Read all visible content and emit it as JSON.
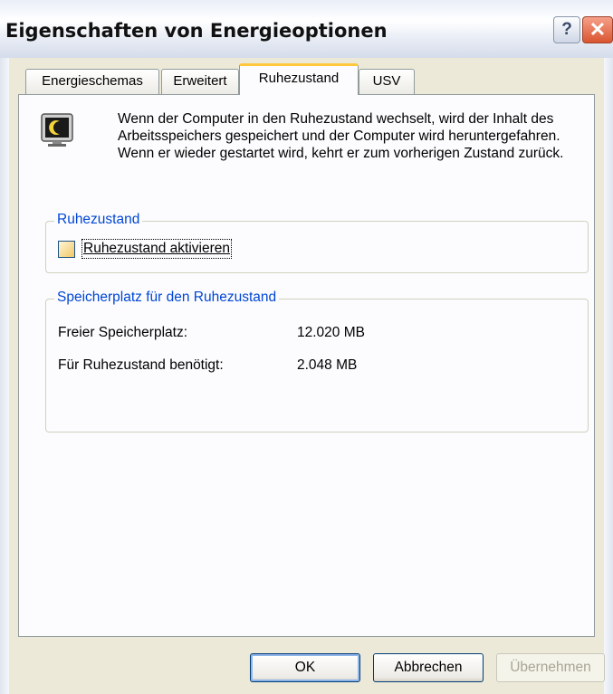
{
  "window": {
    "title": "Eigenschaften von Energieoptionen",
    "help_glyph": "?",
    "close_glyph": "✕"
  },
  "tabs": [
    {
      "label": "Energieschemas",
      "active": false
    },
    {
      "label": "Erweitert",
      "active": false
    },
    {
      "label": "Ruhezustand",
      "active": true
    },
    {
      "label": "USV",
      "active": false
    }
  ],
  "panel": {
    "icon": "hibernate-monitor-icon",
    "description": "Wenn der Computer in den Ruhezustand wechselt, wird der Inhalt des Arbeitsspeichers gespeichert und der Computer wird heruntergefahren. Wenn er wieder gestartet wird, kehrt er zum vorherigen Zustand zurück.",
    "hibernate_group": {
      "title": "Ruhezustand",
      "checkbox_label": "Ruhezustand aktivieren",
      "checked": false
    },
    "space_group": {
      "title": "Speicherplatz für den Ruhezustand",
      "free_label": "Freier Speicherplatz:",
      "free_value": "12.020 MB",
      "required_label": "Für Ruhezustand benötigt:",
      "required_value": "2.048 MB"
    }
  },
  "buttons": {
    "ok": "OK",
    "cancel": "Abbrechen",
    "apply": "Übernehmen"
  }
}
